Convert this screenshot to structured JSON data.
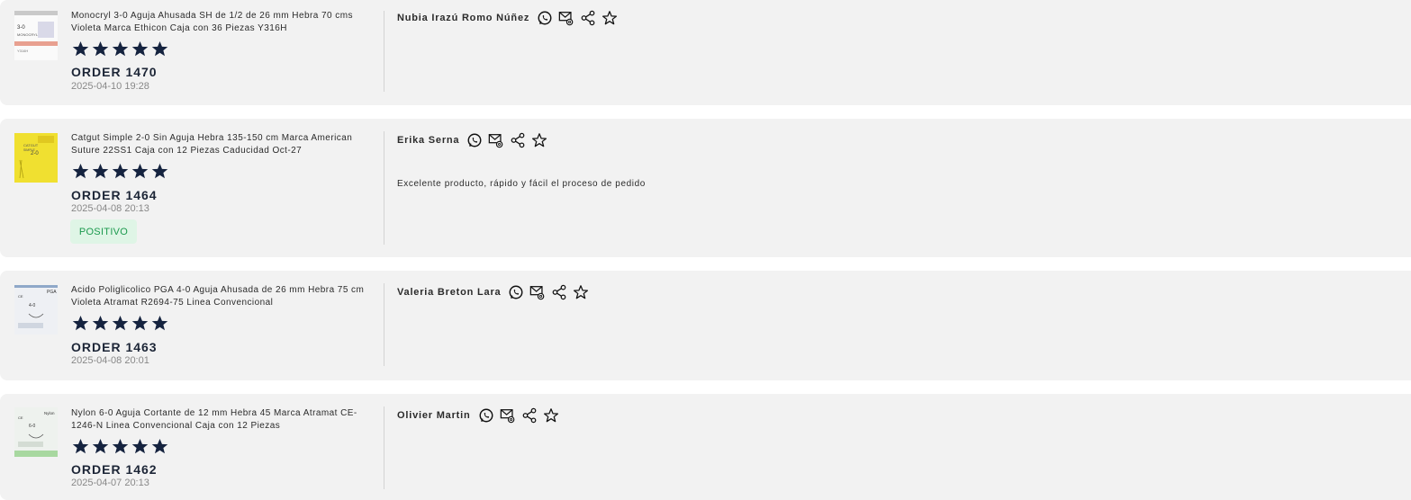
{
  "reviews": [
    {
      "product": "Monocryl 3-0 Aguja Ahusada SH de 1/2 de 26 mm Hebra 70 cms Violeta Marca Ethicon Caja con 36 Piezas Y316H",
      "rating": 5,
      "order": "ORDER 1470",
      "date": "2025-04-10 19:28",
      "customer": "Nubia Irazú Romo Núñez",
      "comment": "",
      "badge": ""
    },
    {
      "product": "Catgut Simple 2-0 Sin Aguja Hebra 135-150 cm Marca American Suture 22SS1 Caja con 12 Piezas Caducidad Oct-27",
      "rating": 5,
      "order": "ORDER 1464",
      "date": "2025-04-08 20:13",
      "customer": "Erika Serna",
      "comment": "Excelente producto, rápido y fácil el proceso de pedido",
      "badge": "POSITIVO"
    },
    {
      "product": "Acido Poliglicolico PGA 4-0 Aguja Ahusada de 26 mm Hebra 75 cm Violeta Atramat R2694-75 Linea Convencional",
      "rating": 5,
      "order": "ORDER 1463",
      "date": "2025-04-08 20:01",
      "customer": "Valeria Breton Lara",
      "comment": "",
      "badge": ""
    },
    {
      "product": "Nylon 6-0 Aguja Cortante de 12 mm Hebra 45 Marca Atramat CE-1246-N Linea Convencional Caja con 12 Piezas",
      "rating": 5,
      "order": "ORDER 1462",
      "date": "2025-04-07 20:13",
      "customer": "Olivier Martin",
      "comment": "",
      "badge": ""
    }
  ],
  "icons": [
    "star-filled-icon",
    "whatsapp-icon",
    "email-icon",
    "share-icon",
    "star-outline-icon"
  ],
  "colors": {
    "card_bg": "#f2f2f2",
    "star": "#15233f",
    "badge_bg": "#dff5e6",
    "badge_text": "#1c9a4e"
  },
  "thumbnails": [
    {
      "lines": [
        "3-0",
        "MONOCRYL",
        "Y316H"
      ],
      "accent": "#e8a090"
    },
    {
      "lines": [
        "2-0",
        "CATGUT",
        "SIMPLE"
      ],
      "accent": "#f0e030"
    },
    {
      "lines": [
        "PGA",
        "4-0",
        "CE"
      ],
      "accent": "#8fa8c8"
    },
    {
      "lines": [
        "Nylon",
        "6-0",
        "CE"
      ],
      "accent": "#a8d8a0"
    }
  ]
}
